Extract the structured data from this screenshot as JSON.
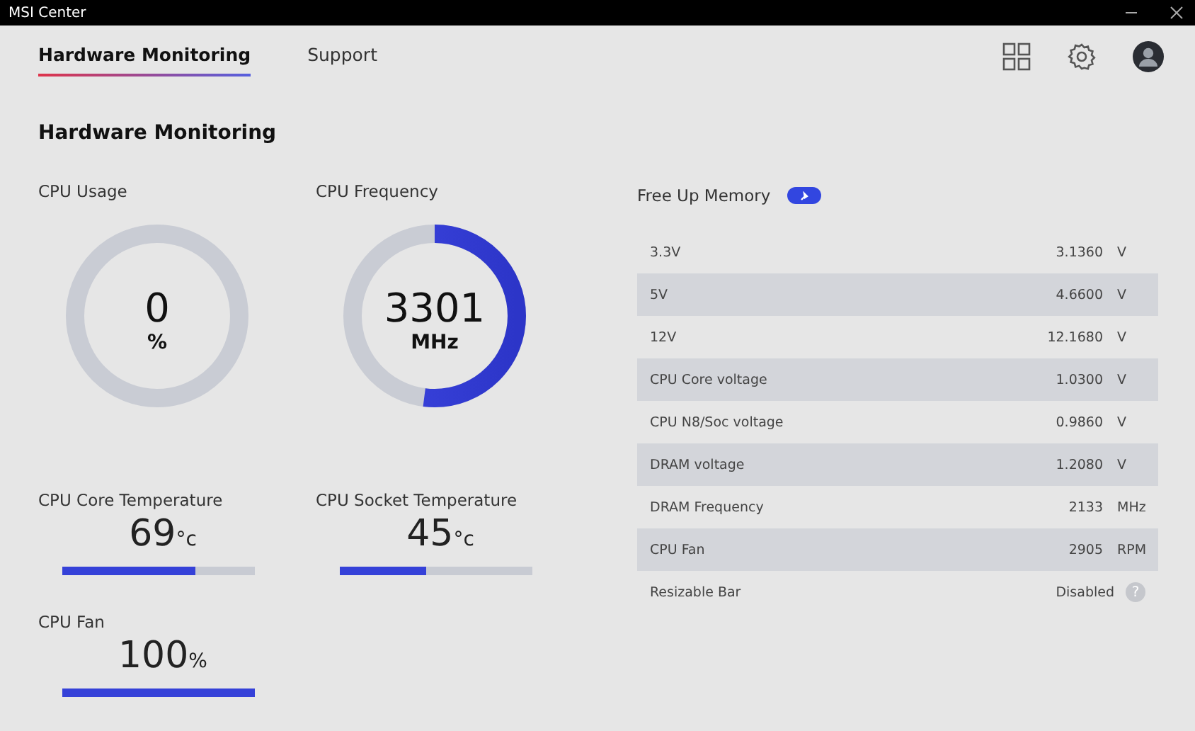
{
  "window": {
    "title": "MSI Center"
  },
  "tabs": [
    {
      "label": "Hardware Monitoring",
      "selected": true
    },
    {
      "label": "Support",
      "selected": false
    }
  ],
  "heading": "Hardware Monitoring",
  "gauges": [
    {
      "label": "CPU Usage",
      "value": "0",
      "unit": "%"
    },
    {
      "label": "CPU Frequency",
      "value": "3301",
      "unit": "MHz"
    }
  ],
  "meters": [
    {
      "label": "CPU Core Temperature",
      "value": "69",
      "unit": "°c",
      "level": 0.69
    },
    {
      "label": "CPU Socket Temperature",
      "value": "45",
      "unit": "°c",
      "level": 0.45
    },
    {
      "label": "CPU Fan",
      "value": "100",
      "unit": "%",
      "level": 1
    }
  ],
  "free_up_memory": {
    "label": "Free Up Memory"
  },
  "sensors": [
    {
      "name": "3.3V",
      "value": "3.1360",
      "unit": "V"
    },
    {
      "name": "5V",
      "value": "4.6600",
      "unit": "V"
    },
    {
      "name": "12V",
      "value": "12.1680",
      "unit": "V"
    },
    {
      "name": "CPU Core voltage",
      "value": "1.0300",
      "unit": "V"
    },
    {
      "name": "CPU N8/Soc voltage",
      "value": "0.9860",
      "unit": "V"
    },
    {
      "name": "DRAM voltage",
      "value": "1.2080",
      "unit": "V"
    },
    {
      "name": "DRAM Frequency",
      "value": "2133",
      "unit": "MHz"
    },
    {
      "name": "CPU Fan",
      "value": "2905",
      "unit": "RPM"
    },
    {
      "name": "Resizable Bar",
      "value": "Disabled",
      "help": "?"
    }
  ]
}
